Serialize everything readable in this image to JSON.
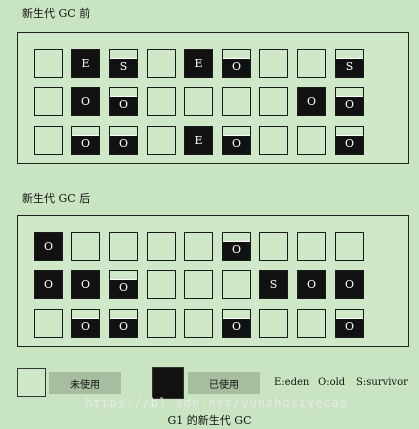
{
  "before": {
    "title": "新生代 GC 前",
    "rows": [
      [
        [
          "empty",
          ""
        ],
        [
          "full",
          "E"
        ],
        [
          "part",
          "S"
        ],
        [
          "empty",
          ""
        ],
        [
          "full",
          "E"
        ],
        [
          "part",
          "O"
        ],
        [
          "empty",
          ""
        ],
        [
          "empty",
          ""
        ],
        [
          "part",
          "S"
        ]
      ],
      [
        [
          "empty",
          ""
        ],
        [
          "full",
          "O"
        ],
        [
          "part",
          "O"
        ],
        [
          "empty",
          ""
        ],
        [
          "empty",
          ""
        ],
        [
          "empty",
          ""
        ],
        [
          "empty",
          ""
        ],
        [
          "full",
          "O"
        ],
        [
          "part",
          "O"
        ]
      ],
      [
        [
          "empty",
          ""
        ],
        [
          "part",
          "O"
        ],
        [
          "part",
          "O"
        ],
        [
          "empty",
          ""
        ],
        [
          "full",
          "E"
        ],
        [
          "part",
          "O"
        ],
        [
          "empty",
          ""
        ],
        [
          "empty",
          ""
        ],
        [
          "part",
          "O"
        ]
      ]
    ]
  },
  "after": {
    "title": "新生代 GC 后",
    "rows": [
      [
        [
          "full",
          "O"
        ],
        [
          "empty",
          ""
        ],
        [
          "empty",
          ""
        ],
        [
          "empty",
          ""
        ],
        [
          "empty",
          ""
        ],
        [
          "part",
          "O"
        ],
        [
          "empty",
          ""
        ],
        [
          "empty",
          ""
        ],
        [
          "empty",
          ""
        ]
      ],
      [
        [
          "full",
          "O"
        ],
        [
          "full",
          "O"
        ],
        [
          "part",
          "O"
        ],
        [
          "empty",
          ""
        ],
        [
          "empty",
          ""
        ],
        [
          "empty",
          ""
        ],
        [
          "full",
          "S"
        ],
        [
          "full",
          "O"
        ],
        [
          "full",
          "O"
        ]
      ],
      [
        [
          "empty",
          ""
        ],
        [
          "part",
          "O"
        ],
        [
          "part",
          "O"
        ],
        [
          "empty",
          ""
        ],
        [
          "empty",
          ""
        ],
        [
          "part",
          "O"
        ],
        [
          "empty",
          ""
        ],
        [
          "empty",
          ""
        ],
        [
          "part",
          "O"
        ]
      ]
    ]
  },
  "legend": {
    "unused": "未使用",
    "used": "已使用",
    "eden": "E:eden",
    "old": "O:old",
    "survivor": "S:survivor"
  },
  "caption": "G1 的新生代 GC",
  "watermark": "https://bl    sdn.net/yunzhosiyecao"
}
